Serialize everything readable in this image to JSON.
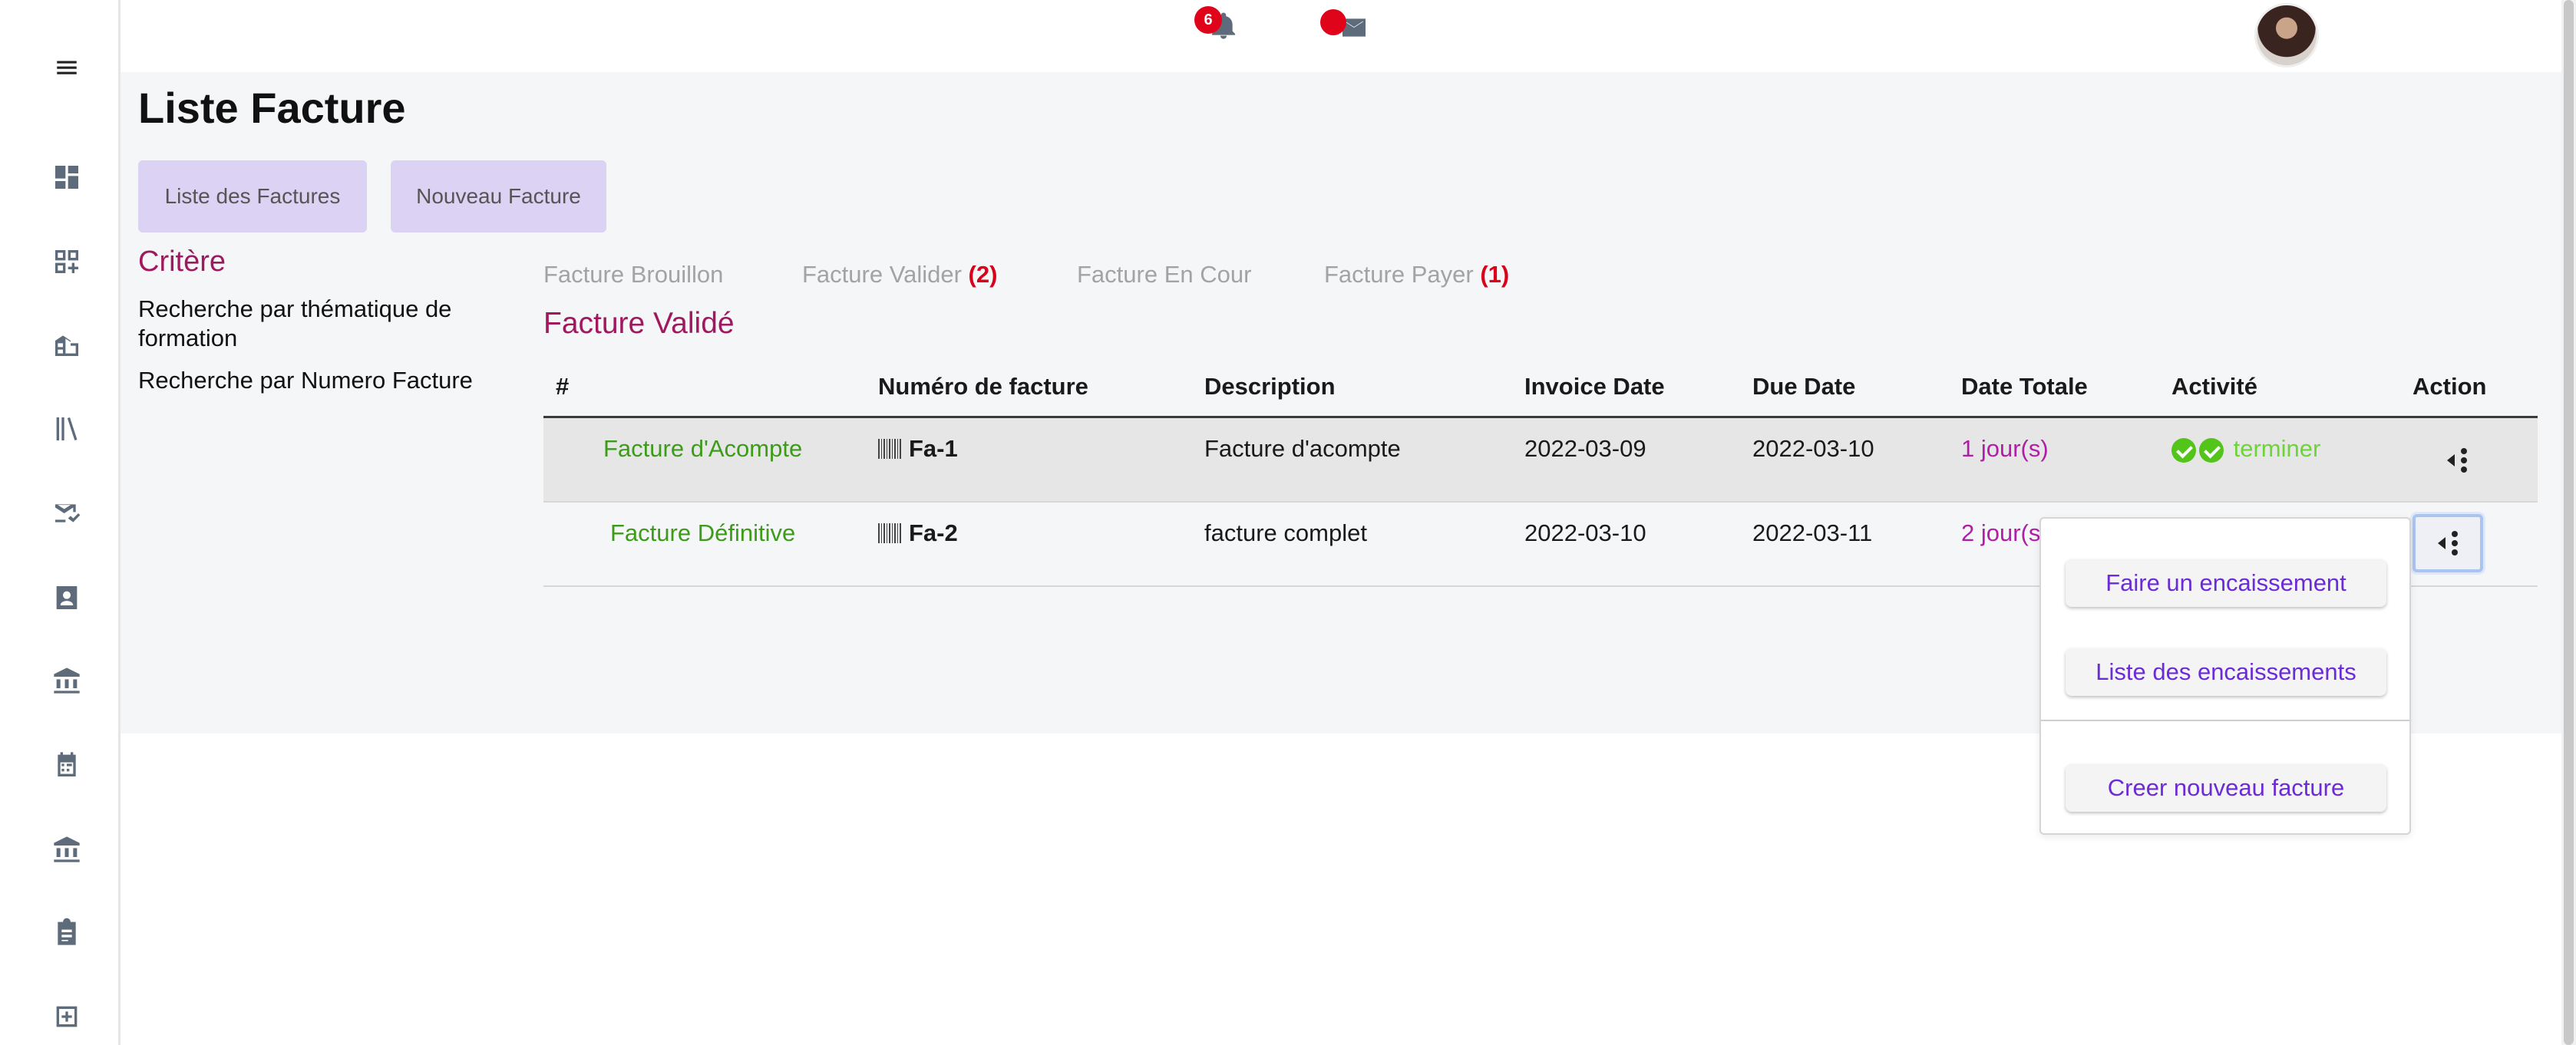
{
  "header": {
    "notifications_count": "6",
    "bell_icon": "bell-icon",
    "mail_icon": "mail-icon"
  },
  "sidebar": {
    "icons": [
      "menu-icon",
      "dashboard-icon",
      "widgets-add-icon",
      "building-icon",
      "library-icon",
      "mark-email-icon",
      "contact-card-icon",
      "bank-icon",
      "calendar-icon",
      "institution-icon",
      "assignment-icon",
      "add-box-icon"
    ]
  },
  "page": {
    "title": "Liste Facture",
    "buttons": {
      "list": "Liste des Factures",
      "new": "Nouveau Facture"
    }
  },
  "filters": {
    "title": "Critère",
    "items": [
      "Recherche par thématique de formation",
      "Recherche par Numero Facture"
    ]
  },
  "tabs": [
    {
      "label": "Facture Brouillon",
      "count": ""
    },
    {
      "label": "Facture Valider",
      "count": "(2)"
    },
    {
      "label": "Facture En Cour",
      "count": ""
    },
    {
      "label": "Facture Payer",
      "count": "(1)"
    }
  ],
  "section_title": "Facture Validé",
  "table": {
    "headers": [
      "#",
      "Numéro de facture",
      "Description",
      "Invoice Date",
      "Due Date",
      "Date Totale",
      "Activité",
      "Action"
    ],
    "rows": [
      {
        "type": "Facture d'Acompte",
        "number": "Fa-1",
        "description": "Facture d'acompte",
        "invoice_date": "2022-03-09",
        "due_date": "2022-03-10",
        "total": "1 jour(s)",
        "activity": "terminer"
      },
      {
        "type": "Facture Définitive",
        "number": "Fa-2",
        "description": "facture complet",
        "invoice_date": "2022-03-10",
        "due_date": "2022-03-11",
        "total": "2 jour(s)",
        "activity": ""
      }
    ]
  },
  "dropdown": {
    "items": [
      "Faire un encaissement",
      "Liste des encaissements",
      "Creer nouveau facture"
    ]
  },
  "colors": {
    "accent_magenta": "#a0185f",
    "green": "#3d9b1a",
    "purple": "#b01ea8",
    "button_bg": "#dcd2f3",
    "badge_red": "#e0041a"
  }
}
